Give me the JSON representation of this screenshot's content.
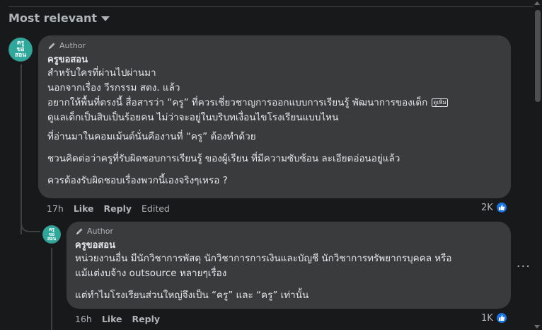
{
  "sort": {
    "label": "Most relevant",
    "icon": "caret-down-icon"
  },
  "comments": [
    {
      "avatar_lines": [
        "ครู",
        "ขอ",
        "สอน"
      ],
      "author_badge": "Author",
      "name": "ครูขอสอน",
      "lines": [
        "สำหรับใครที่ผ่านไปผ่านมา",
        "นอกจากเรื่อง วีรกรรม สตง. แล้ว",
        "อยากให้พื้นที่ตรงนี้ สื่อสารว่า “ครู” ที่ควรเชี่ยวชาญการออกแบบการเรียนรู้ พัฒนาการของเด็ก",
        "ดูแลเด็กเป็นสิบเป็นร้อยคน ไม่ว่าจะอยู่ในบริบทเงื่อนไขโรงเรียนแบบไหน",
        "",
        "ที่อ่านมาในคอมเม้นต์นั่นคืองานที่ “ครู” ต้องทำด้วย",
        "",
        "ชวนคิดต่อว่าครูที่รับผิดชอบการเรียนรู้ ของผู้เรียน ที่มีความซับซ้อน ละเอียดอ่อนอยู่แล้ว",
        "",
        "ควรต้องรับผิดชอบเรื่องพวกนี้เองจริงๆเหรอ ?"
      ],
      "truncated_chip": "ดูเพิ่ม",
      "time": "17h",
      "like": "Like",
      "reply": "Reply",
      "edited": "Edited",
      "reaction_count": "2K"
    },
    {
      "avatar_lines": [
        "ครู",
        "ขอ",
        "สอน"
      ],
      "author_badge": "Author",
      "name": "ครูขอสอน",
      "lines": [
        "หน่วยงานอื่น มีนักวิชาการพัสดุ นักวิชาการการเงินและบัญชี นักวิชาการทรัพยากรบุคคล หรือ",
        "แม้แต่งบจ้าง outsource หลายๆเรื่อง",
        "",
        "แต่ทำไมโรงเรียนส่วนใหญ่จึงเป็น “ครู” และ “ครู” เท่านั้น"
      ],
      "time": "16h",
      "like": "Like",
      "reply": "Reply",
      "reaction_count": "1K"
    }
  ],
  "colors": {
    "bubble": "#3a3b3c",
    "background": "#18191a",
    "like_blue": "#1b74e4",
    "avatar": "#2ea89b"
  }
}
